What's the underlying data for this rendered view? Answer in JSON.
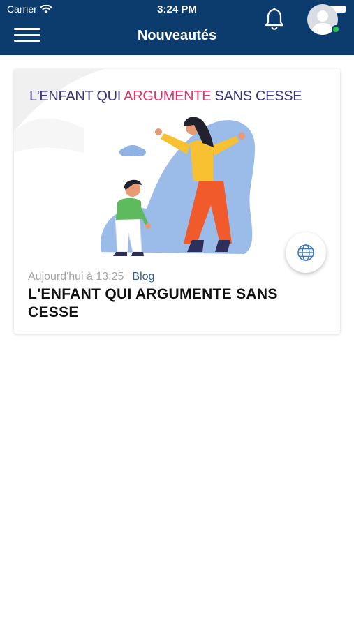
{
  "status_bar": {
    "carrier": "Carrier",
    "time": "3:24 PM"
  },
  "nav": {
    "title": "Nouveautés"
  },
  "card": {
    "image_heading": {
      "part1": "L'ENFANT QUI ",
      "part2": "ARGUMENTE",
      "part3": " SANS CESSE"
    },
    "meta_date": "Aujourd'hui à 13:25",
    "meta_category": "Blog",
    "title": "L'ENFANT QUI ARGUMENTE SANS CESSE"
  },
  "icons": [
    "menu-icon",
    "bell-icon",
    "avatar",
    "globe-icon",
    "wifi-icon"
  ],
  "colors": {
    "header": "#0c3b6e",
    "accent_pink": "#e0336f",
    "category": "#2e5f8f",
    "online": "#27c24c"
  }
}
